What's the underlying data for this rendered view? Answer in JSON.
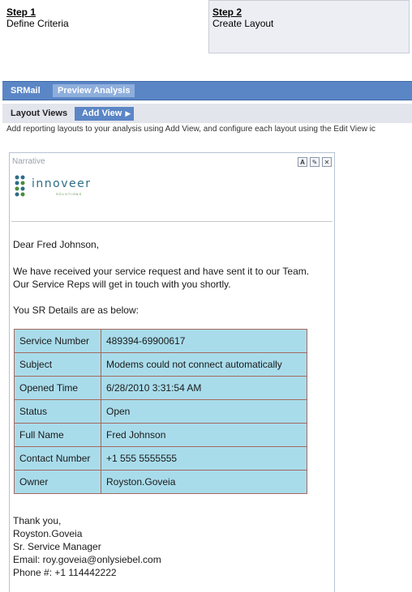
{
  "steps": [
    {
      "title": "Step 1",
      "subtitle": "Define Criteria"
    },
    {
      "title": "Step 2",
      "subtitle": "Create Layout"
    }
  ],
  "header": {
    "title": "SRMail",
    "tab": "Preview Analysis"
  },
  "layout_views": {
    "label": "Layout Views",
    "add_view": "Add View"
  },
  "instructions": "Add reporting layouts to your analysis using Add View, and configure each layout using the Edit View ic",
  "narrative": {
    "label": "Narrative",
    "logo": {
      "name": "innoveer",
      "tagline": "SOLUTIONS"
    },
    "greeting": "Dear Fred Johnson,",
    "paragraph1_line1": "We have received your service request and have sent it to our Team.",
    "paragraph1_line2": "Our Service Reps will get in touch with you shortly.",
    "details_intro": "You SR Details are as below:",
    "details": [
      {
        "key": "Service Number",
        "value": "489394-69900617"
      },
      {
        "key": "Subject",
        "value": "Modems could not connect automatically"
      },
      {
        "key": "Opened Time",
        "value": "6/28/2010 3:31:54 AM"
      },
      {
        "key": "Status",
        "value": "Open"
      },
      {
        "key": "Full Name",
        "value": "Fred Johnson"
      },
      {
        "key": "Contact Number",
        "value": "+1 555 5555555"
      },
      {
        "key": "Owner",
        "value": "Royston.Goveia"
      }
    ],
    "signature": {
      "closing": "Thank you,",
      "name": "Royston.Goveia",
      "role": "Sr. Service Manager",
      "email": "Email: roy.goveia@onlysiebel.com",
      "phone": "Phone #: +1 114442222"
    }
  },
  "colors": {
    "header_blue": "#5b86c6",
    "table_bg": "#a9dceb",
    "table_border": "#a46a5f"
  }
}
